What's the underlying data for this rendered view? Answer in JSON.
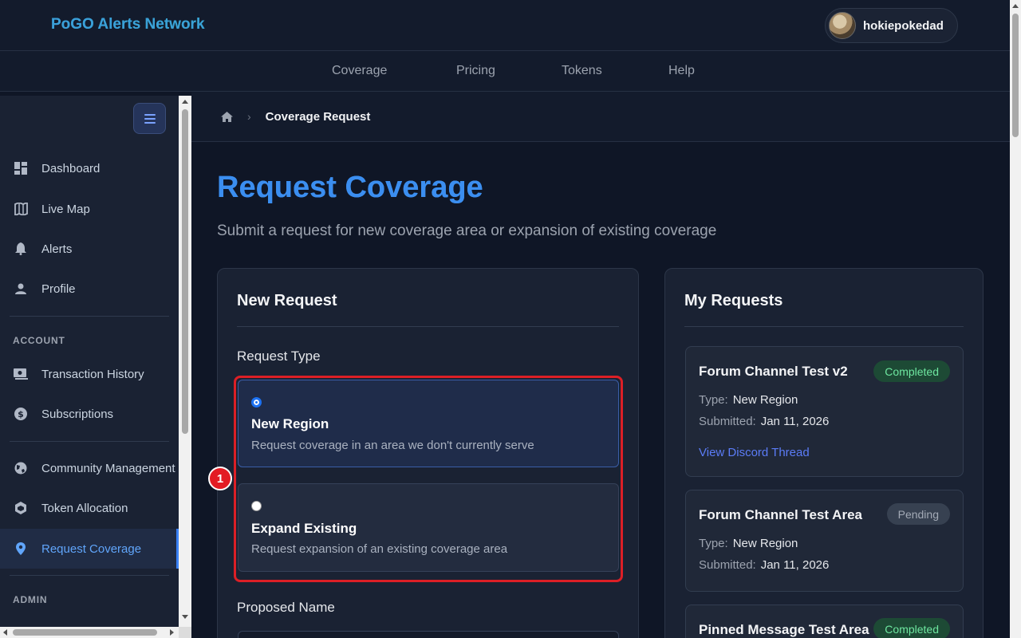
{
  "app": {
    "brand": "PoGO Alerts Network",
    "user_name": "hokiepokedad"
  },
  "nav": {
    "items": [
      {
        "label": "Coverage"
      },
      {
        "label": "Pricing"
      },
      {
        "label": "Tokens"
      },
      {
        "label": "Help"
      }
    ]
  },
  "sidebar": {
    "items": [
      {
        "label": "Dashboard",
        "icon": "dashboard-icon"
      },
      {
        "label": "Live Map",
        "icon": "map-icon"
      },
      {
        "label": "Alerts",
        "icon": "bell-icon"
      },
      {
        "label": "Profile",
        "icon": "person-icon"
      }
    ],
    "account_title": "ACCOUNT",
    "account_items": [
      {
        "label": "Transaction History",
        "icon": "receipt-icon"
      },
      {
        "label": "Subscriptions",
        "icon": "dollar-icon"
      }
    ],
    "community_items": [
      {
        "label": "Community Management",
        "icon": "globe-icon"
      },
      {
        "label": "Token Allocation",
        "icon": "token-icon"
      },
      {
        "label": "Request Coverage",
        "icon": "location-pin-icon",
        "active": true
      }
    ],
    "admin_title": "ADMIN"
  },
  "breadcrumb": {
    "current": "Coverage Request",
    "separator": "›"
  },
  "page": {
    "title": "Request Coverage",
    "subtitle": "Submit a request for new coverage area or expansion of existing coverage"
  },
  "new_request": {
    "title": "New Request",
    "request_type_label": "Request Type",
    "options": [
      {
        "title": "New Region",
        "description": "Request coverage in an area we don't currently serve",
        "selected": true
      },
      {
        "title": "Expand Existing",
        "description": "Request expansion of an existing coverage area",
        "selected": false
      }
    ],
    "proposed_name_label": "Proposed Name",
    "annotation_marker": "1"
  },
  "my_requests": {
    "title": "My Requests",
    "type_label": "Type:",
    "submitted_label": "Submitted:",
    "items": [
      {
        "name": "Forum Channel Test v2",
        "status": "Completed",
        "type": "New Region",
        "submitted": "Jan 11, 2026",
        "link": "View Discord Thread"
      },
      {
        "name": "Forum Channel Test Area",
        "status": "Pending",
        "type": "New Region",
        "submitted": "Jan 11, 2026"
      },
      {
        "name": "Pinned Message Test Area",
        "status": "Completed"
      }
    ]
  },
  "colors": {
    "accent": "#3b82f6",
    "highlight": "#dc1f26",
    "completed": "#6ee7a0",
    "pending": "#a3aab6"
  }
}
